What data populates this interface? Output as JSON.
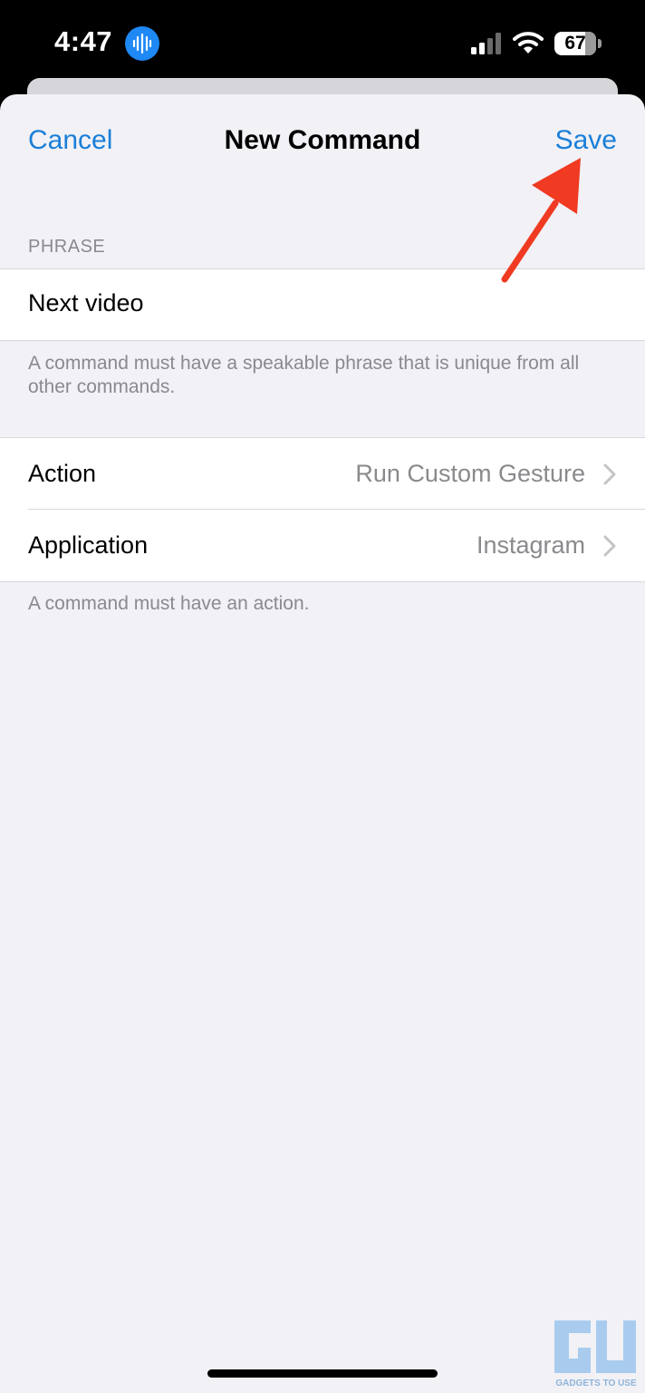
{
  "status_bar": {
    "time": "4:47",
    "battery_level": "67",
    "icons": [
      "voice-memo-icon",
      "cellular-signal-icon",
      "wifi-icon",
      "battery-icon"
    ]
  },
  "nav": {
    "cancel_label": "Cancel",
    "title": "New Command",
    "save_label": "Save"
  },
  "phrase_section": {
    "header": "PHRASE",
    "value": "Next video",
    "footer": "A command must have a speakable phrase that is unique from all other commands."
  },
  "action_section": {
    "rows": [
      {
        "label": "Action",
        "value": "Run Custom Gesture"
      },
      {
        "label": "Application",
        "value": "Instagram"
      }
    ],
    "footer": "A command must have an action."
  },
  "watermark": {
    "logo_text": "GU",
    "caption": "GADGETS TO USE"
  },
  "colors": {
    "accent": "#1a7fd8",
    "annotation": "#f03a22",
    "sheet_background": "#f1f1f6",
    "secondary_text": "#8a8a8e"
  }
}
